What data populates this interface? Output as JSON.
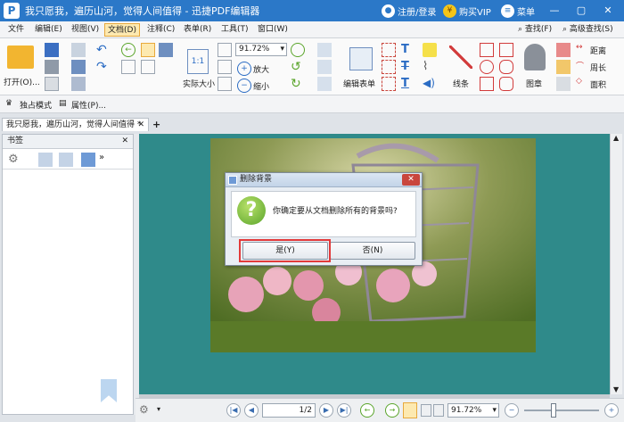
{
  "window": {
    "title": "我只愿我，遍历山河，觉得人间值得 - 迅捷PDF编辑器",
    "login": "注册/登录",
    "vip": "购买VIP",
    "menu": "菜单"
  },
  "menubar": {
    "items": [
      "文件",
      "编辑(E)",
      "视图(V)",
      "文档(D)",
      "注释(C)",
      "表单(R)",
      "工具(T)",
      "窗口(W)"
    ],
    "find": "查找(F)",
    "advanced_find": "高级查找(S)"
  },
  "ribbon": {
    "open": "打开(O)...",
    "zoom_value": "91.72%",
    "actual_size": "实际大小",
    "zoom_in": "放大",
    "zoom_out": "缩小",
    "edit_form": "编辑表单",
    "lines": "线条",
    "stamp": "图章",
    "distance": "距离",
    "perimeter": "周长",
    "area": "面积"
  },
  "ribbon2": {
    "exclusive_mode": "独占模式",
    "properties": "属性(P)..."
  },
  "tab": {
    "label": "我只愿我，遍历山河，觉得人间值得 *",
    "add": "+"
  },
  "sidebar": {
    "title": "书签"
  },
  "dialog": {
    "title": "删除背景",
    "message": "你确定要从文档删除所有的背景吗?",
    "yes": "是(Y)",
    "no": "否(N)",
    "close": "✕"
  },
  "statusbar": {
    "page_current": "1",
    "page_total": "/2",
    "zoom": "91.72%"
  },
  "colors": {
    "titlebar": "#2b78c8",
    "viewer_bg": "#2f8a8a",
    "highlight": "#e23a3a"
  }
}
